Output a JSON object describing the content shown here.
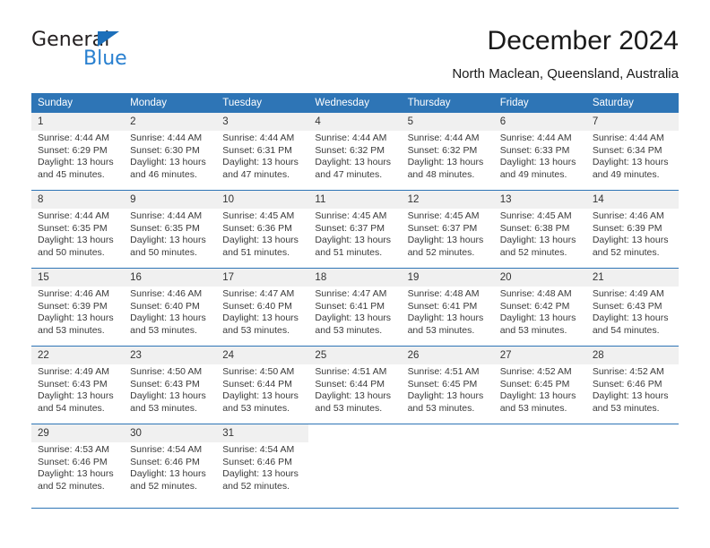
{
  "logo": {
    "word_one": "General",
    "word_two": "Blue",
    "triangle_color": "#1c6fba",
    "blue_color": "#2980d0"
  },
  "header": {
    "title": "December 2024",
    "location": "North Maclean, Queensland, Australia"
  },
  "theme": {
    "header_bar": "#2e75b6",
    "date_band": "#f0f0f0",
    "rule": "#2e75b6"
  },
  "weekdays": [
    "Sunday",
    "Monday",
    "Tuesday",
    "Wednesday",
    "Thursday",
    "Friday",
    "Saturday"
  ],
  "weeks": [
    [
      {
        "day": "1",
        "sunrise": "Sunrise: 4:44 AM",
        "sunset": "Sunset: 6:29 PM",
        "daylight1": "Daylight: 13 hours",
        "daylight2": "and 45 minutes."
      },
      {
        "day": "2",
        "sunrise": "Sunrise: 4:44 AM",
        "sunset": "Sunset: 6:30 PM",
        "daylight1": "Daylight: 13 hours",
        "daylight2": "and 46 minutes."
      },
      {
        "day": "3",
        "sunrise": "Sunrise: 4:44 AM",
        "sunset": "Sunset: 6:31 PM",
        "daylight1": "Daylight: 13 hours",
        "daylight2": "and 47 minutes."
      },
      {
        "day": "4",
        "sunrise": "Sunrise: 4:44 AM",
        "sunset": "Sunset: 6:32 PM",
        "daylight1": "Daylight: 13 hours",
        "daylight2": "and 47 minutes."
      },
      {
        "day": "5",
        "sunrise": "Sunrise: 4:44 AM",
        "sunset": "Sunset: 6:32 PM",
        "daylight1": "Daylight: 13 hours",
        "daylight2": "and 48 minutes."
      },
      {
        "day": "6",
        "sunrise": "Sunrise: 4:44 AM",
        "sunset": "Sunset: 6:33 PM",
        "daylight1": "Daylight: 13 hours",
        "daylight2": "and 49 minutes."
      },
      {
        "day": "7",
        "sunrise": "Sunrise: 4:44 AM",
        "sunset": "Sunset: 6:34 PM",
        "daylight1": "Daylight: 13 hours",
        "daylight2": "and 49 minutes."
      }
    ],
    [
      {
        "day": "8",
        "sunrise": "Sunrise: 4:44 AM",
        "sunset": "Sunset: 6:35 PM",
        "daylight1": "Daylight: 13 hours",
        "daylight2": "and 50 minutes."
      },
      {
        "day": "9",
        "sunrise": "Sunrise: 4:44 AM",
        "sunset": "Sunset: 6:35 PM",
        "daylight1": "Daylight: 13 hours",
        "daylight2": "and 50 minutes."
      },
      {
        "day": "10",
        "sunrise": "Sunrise: 4:45 AM",
        "sunset": "Sunset: 6:36 PM",
        "daylight1": "Daylight: 13 hours",
        "daylight2": "and 51 minutes."
      },
      {
        "day": "11",
        "sunrise": "Sunrise: 4:45 AM",
        "sunset": "Sunset: 6:37 PM",
        "daylight1": "Daylight: 13 hours",
        "daylight2": "and 51 minutes."
      },
      {
        "day": "12",
        "sunrise": "Sunrise: 4:45 AM",
        "sunset": "Sunset: 6:37 PM",
        "daylight1": "Daylight: 13 hours",
        "daylight2": "and 52 minutes."
      },
      {
        "day": "13",
        "sunrise": "Sunrise: 4:45 AM",
        "sunset": "Sunset: 6:38 PM",
        "daylight1": "Daylight: 13 hours",
        "daylight2": "and 52 minutes."
      },
      {
        "day": "14",
        "sunrise": "Sunrise: 4:46 AM",
        "sunset": "Sunset: 6:39 PM",
        "daylight1": "Daylight: 13 hours",
        "daylight2": "and 52 minutes."
      }
    ],
    [
      {
        "day": "15",
        "sunrise": "Sunrise: 4:46 AM",
        "sunset": "Sunset: 6:39 PM",
        "daylight1": "Daylight: 13 hours",
        "daylight2": "and 53 minutes."
      },
      {
        "day": "16",
        "sunrise": "Sunrise: 4:46 AM",
        "sunset": "Sunset: 6:40 PM",
        "daylight1": "Daylight: 13 hours",
        "daylight2": "and 53 minutes."
      },
      {
        "day": "17",
        "sunrise": "Sunrise: 4:47 AM",
        "sunset": "Sunset: 6:40 PM",
        "daylight1": "Daylight: 13 hours",
        "daylight2": "and 53 minutes."
      },
      {
        "day": "18",
        "sunrise": "Sunrise: 4:47 AM",
        "sunset": "Sunset: 6:41 PM",
        "daylight1": "Daylight: 13 hours",
        "daylight2": "and 53 minutes."
      },
      {
        "day": "19",
        "sunrise": "Sunrise: 4:48 AM",
        "sunset": "Sunset: 6:41 PM",
        "daylight1": "Daylight: 13 hours",
        "daylight2": "and 53 minutes."
      },
      {
        "day": "20",
        "sunrise": "Sunrise: 4:48 AM",
        "sunset": "Sunset: 6:42 PM",
        "daylight1": "Daylight: 13 hours",
        "daylight2": "and 53 minutes."
      },
      {
        "day": "21",
        "sunrise": "Sunrise: 4:49 AM",
        "sunset": "Sunset: 6:43 PM",
        "daylight1": "Daylight: 13 hours",
        "daylight2": "and 54 minutes."
      }
    ],
    [
      {
        "day": "22",
        "sunrise": "Sunrise: 4:49 AM",
        "sunset": "Sunset: 6:43 PM",
        "daylight1": "Daylight: 13 hours",
        "daylight2": "and 54 minutes."
      },
      {
        "day": "23",
        "sunrise": "Sunrise: 4:50 AM",
        "sunset": "Sunset: 6:43 PM",
        "daylight1": "Daylight: 13 hours",
        "daylight2": "and 53 minutes."
      },
      {
        "day": "24",
        "sunrise": "Sunrise: 4:50 AM",
        "sunset": "Sunset: 6:44 PM",
        "daylight1": "Daylight: 13 hours",
        "daylight2": "and 53 minutes."
      },
      {
        "day": "25",
        "sunrise": "Sunrise: 4:51 AM",
        "sunset": "Sunset: 6:44 PM",
        "daylight1": "Daylight: 13 hours",
        "daylight2": "and 53 minutes."
      },
      {
        "day": "26",
        "sunrise": "Sunrise: 4:51 AM",
        "sunset": "Sunset: 6:45 PM",
        "daylight1": "Daylight: 13 hours",
        "daylight2": "and 53 minutes."
      },
      {
        "day": "27",
        "sunrise": "Sunrise: 4:52 AM",
        "sunset": "Sunset: 6:45 PM",
        "daylight1": "Daylight: 13 hours",
        "daylight2": "and 53 minutes."
      },
      {
        "day": "28",
        "sunrise": "Sunrise: 4:52 AM",
        "sunset": "Sunset: 6:46 PM",
        "daylight1": "Daylight: 13 hours",
        "daylight2": "and 53 minutes."
      }
    ],
    [
      {
        "day": "29",
        "sunrise": "Sunrise: 4:53 AM",
        "sunset": "Sunset: 6:46 PM",
        "daylight1": "Daylight: 13 hours",
        "daylight2": "and 52 minutes."
      },
      {
        "day": "30",
        "sunrise": "Sunrise: 4:54 AM",
        "sunset": "Sunset: 6:46 PM",
        "daylight1": "Daylight: 13 hours",
        "daylight2": "and 52 minutes."
      },
      {
        "day": "31",
        "sunrise": "Sunrise: 4:54 AM",
        "sunset": "Sunset: 6:46 PM",
        "daylight1": "Daylight: 13 hours",
        "daylight2": "and 52 minutes."
      },
      null,
      null,
      null,
      null
    ]
  ]
}
